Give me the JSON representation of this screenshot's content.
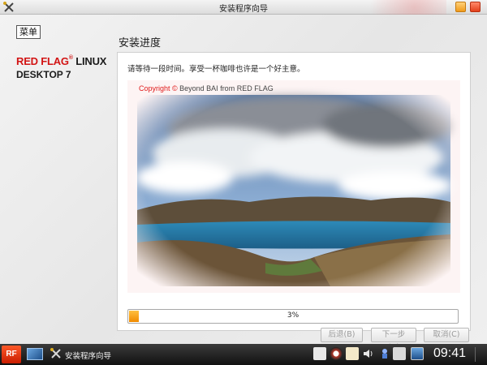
{
  "window": {
    "title": "安装程序向导",
    "menu_label": "菜单"
  },
  "brand": {
    "red_part": "RED FLAG",
    "reg_mark": "®",
    "black_part": " LINUX",
    "line2": "DESKTOP 7"
  },
  "page": {
    "title": "安装进度",
    "wait_text": "请等待一段时间。享受一杯咖啡也许是一个好主意。"
  },
  "slide": {
    "copyright_red": "Copyright © ",
    "copyright_rest": "Beyond BAI from RED FLAG"
  },
  "progress": {
    "percent_label": "3%",
    "value": 3
  },
  "buttons": {
    "back": "后退(B)",
    "next": "下一步(N)",
    "cancel": "取消(C)"
  },
  "taskbar": {
    "start_label": "RF",
    "task_label": "安装程序向导",
    "clock": "09:41"
  },
  "colors": {
    "brand_red": "#d21414",
    "progress_orange": "#f08a00"
  },
  "icons": {
    "app": "tools-icon",
    "minimize": "minimize-icon",
    "close": "close-icon",
    "show_desktop": "show-desktop-icon",
    "tray": [
      "keyboard-icon",
      "chat-icon",
      "clipboard-icon",
      "volume-icon",
      "mail-icon",
      "network-icon",
      "battery-icon",
      "display-icon"
    ]
  }
}
